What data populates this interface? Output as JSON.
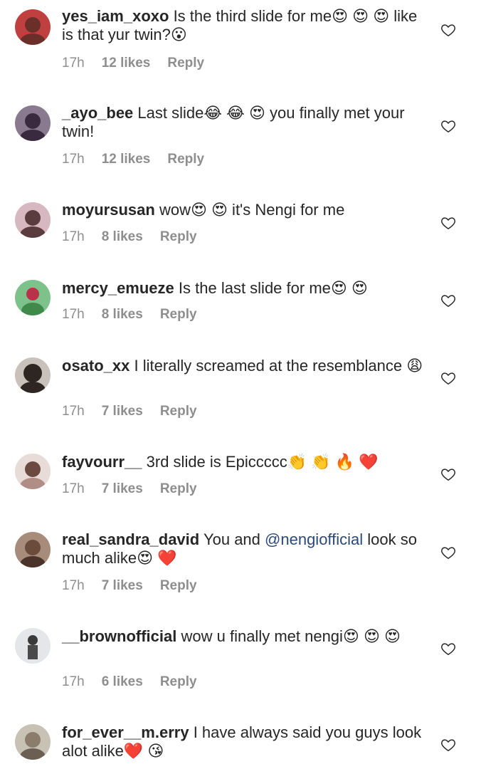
{
  "comments": [
    {
      "user": "yes_iam_xoxo",
      "text": "Is the third slide for me😍 😍 😍 like is that yur twin?😮",
      "time": "17h",
      "likes": "12 likes",
      "reply": "Reply",
      "avatar": "#6b2f2a"
    },
    {
      "user": "_ayo_bee",
      "text": "Last slide😂 😂 😍 you finally met your twin!",
      "time": "17h",
      "likes": "12 likes",
      "reply": "Reply",
      "avatar": "#4a3a55"
    },
    {
      "user": "moyursusan",
      "text": "wow😍 😍  it's Nengi for me",
      "time": "17h",
      "likes": "8 likes",
      "reply": "Reply",
      "avatar": "#5a3b3e"
    },
    {
      "user": "mercy_emueze",
      "text": "Is the last slide for me😍 😍",
      "time": "17h",
      "likes": "8 likes",
      "reply": "Reply",
      "avatar": "#3f8a4a"
    },
    {
      "user": "osato_xx",
      "text": "I literally screamed at the resemblance 😩",
      "time": "17h",
      "likes": "7 likes",
      "reply": "Reply",
      "avatar": "#2e2622"
    },
    {
      "user": "fayvourr__",
      "text": "3rd slide is Epiccccc👏 👏 🔥 ❤️",
      "time": "17h",
      "likes": "7 likes",
      "reply": "Reply",
      "avatar": "#b08e86"
    },
    {
      "user": "real_sandra_david",
      "text": "You and",
      "mention": "@nengiofficial",
      "text_after": "look so much alike😍 ❤️",
      "time": "17h",
      "likes": "7 likes",
      "reply": "Reply",
      "avatar": "#6b4c3c"
    },
    {
      "user": "__brownofficial",
      "text": "wow u finally met nengi😍 😍 😍",
      "time": "17h",
      "likes": "6 likes",
      "reply": "Reply",
      "avatar": "#9aa0a8"
    },
    {
      "user": "for_ever__m.erry",
      "text": "I have always said you guys look alot alike❤️ 😘",
      "time": "",
      "likes": "",
      "reply": "",
      "avatar": "#8a7d6c"
    }
  ],
  "icons": {
    "like": "heart-outline-icon"
  }
}
